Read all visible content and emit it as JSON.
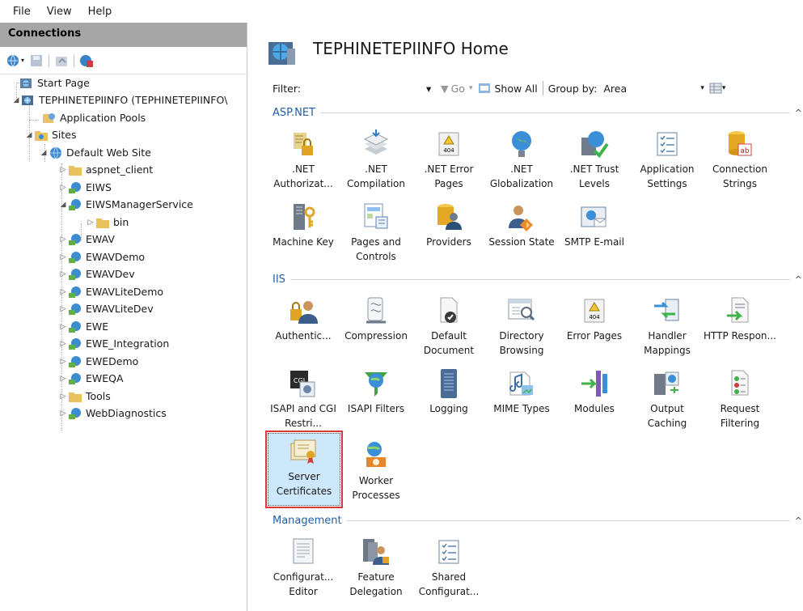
{
  "menu": [
    "File",
    "View",
    "Help"
  ],
  "connections": {
    "header": "Connections",
    "tree": [
      {
        "label": "Start Page",
        "depth": 0,
        "icon": "start-page-icon",
        "expander": ""
      },
      {
        "label": "TEPHINETEPIINFO (TEPHINETEPIINFO\\",
        "depth": 0,
        "icon": "server-icon",
        "expander": "open"
      },
      {
        "label": "Application Pools",
        "depth": 1,
        "icon": "app-pool-icon",
        "expander": ""
      },
      {
        "label": "Sites",
        "depth": 1,
        "icon": "sites-folder-icon",
        "expander": "open"
      },
      {
        "label": "Default Web Site",
        "depth": 2,
        "icon": "globe-icon",
        "expander": "open"
      },
      {
        "label": "aspnet_client",
        "depth": 3,
        "icon": "folder-icon",
        "expander": "closed"
      },
      {
        "label": "EIWS",
        "depth": 3,
        "icon": "web-app-icon",
        "expander": "closed"
      },
      {
        "label": "EIWSManagerService",
        "depth": 3,
        "icon": "web-app-icon",
        "expander": "open"
      },
      {
        "label": "bin",
        "depth": 4,
        "icon": "folder-icon",
        "expander": "closed"
      },
      {
        "label": "EWAV",
        "depth": 3,
        "icon": "web-app-icon",
        "expander": "closed"
      },
      {
        "label": "EWAVDemo",
        "depth": 3,
        "icon": "web-app-icon",
        "expander": "closed"
      },
      {
        "label": "EWAVDev",
        "depth": 3,
        "icon": "web-app-icon",
        "expander": "closed"
      },
      {
        "label": "EWAVLiteDemo",
        "depth": 3,
        "icon": "web-app-icon",
        "expander": "closed"
      },
      {
        "label": "EWAVLiteDev",
        "depth": 3,
        "icon": "web-app-icon",
        "expander": "closed"
      },
      {
        "label": "EWE",
        "depth": 3,
        "icon": "web-app-icon",
        "expander": "closed"
      },
      {
        "label": "EWE_Integration",
        "depth": 3,
        "icon": "web-app-icon",
        "expander": "closed"
      },
      {
        "label": "EWEDemo",
        "depth": 3,
        "icon": "web-app-icon",
        "expander": "closed"
      },
      {
        "label": "EWEQA",
        "depth": 3,
        "icon": "web-app-icon",
        "expander": "closed"
      },
      {
        "label": "Tools",
        "depth": 3,
        "icon": "folder-icon",
        "expander": "closed"
      },
      {
        "label": "WebDiagnostics",
        "depth": 3,
        "icon": "web-app-icon",
        "expander": "closed"
      }
    ]
  },
  "main": {
    "title": "TEPHINETEPIINFO Home",
    "filter": {
      "label": "Filter:",
      "go": "Go",
      "show_all": "Show All",
      "group_by_label": "Group by:",
      "group_by_value": "Area"
    },
    "sections": [
      {
        "title": "ASP.NET",
        "items": [
          {
            "label": ".NET Authorizat...",
            "icon": "net-authorization-icon"
          },
          {
            "label": ".NET Compilation",
            "icon": "net-compilation-icon"
          },
          {
            "label": ".NET Error Pages",
            "icon": "net-error-pages-icon"
          },
          {
            "label": ".NET Globalization",
            "icon": "net-globalization-icon"
          },
          {
            "label": ".NET Trust Levels",
            "icon": "net-trust-levels-icon"
          },
          {
            "label": "Application Settings",
            "icon": "application-settings-icon"
          },
          {
            "label": "Connection Strings",
            "icon": "connection-strings-icon"
          },
          {
            "label": "Machine Key",
            "icon": "machine-key-icon"
          },
          {
            "label": "Pages and Controls",
            "icon": "pages-and-controls-icon"
          },
          {
            "label": "Providers",
            "icon": "providers-icon"
          },
          {
            "label": "Session State",
            "icon": "session-state-icon"
          },
          {
            "label": "SMTP E-mail",
            "icon": "smtp-email-icon"
          }
        ]
      },
      {
        "title": "IIS",
        "items": [
          {
            "label": "Authentic...",
            "icon": "authentication-icon"
          },
          {
            "label": "Compression",
            "icon": "compression-icon"
          },
          {
            "label": "Default Document",
            "icon": "default-document-icon"
          },
          {
            "label": "Directory Browsing",
            "icon": "directory-browsing-icon"
          },
          {
            "label": "Error Pages",
            "icon": "error-pages-icon"
          },
          {
            "label": "Handler Mappings",
            "icon": "handler-mappings-icon"
          },
          {
            "label": "HTTP Respon...",
            "icon": "http-response-icon"
          },
          {
            "label": "ISAPI and CGI Restri...",
            "icon": "isapi-cgi-icon"
          },
          {
            "label": "ISAPI Filters",
            "icon": "isapi-filters-icon"
          },
          {
            "label": "Logging",
            "icon": "logging-icon"
          },
          {
            "label": "MIME Types",
            "icon": "mime-types-icon"
          },
          {
            "label": "Modules",
            "icon": "modules-icon"
          },
          {
            "label": "Output Caching",
            "icon": "output-caching-icon"
          },
          {
            "label": "Request Filtering",
            "icon": "request-filtering-icon"
          },
          {
            "label": "Server Certificates",
            "icon": "server-certificates-icon",
            "selected": true
          },
          {
            "label": "Worker Processes",
            "icon": "worker-processes-icon"
          }
        ]
      },
      {
        "title": "Management",
        "items": [
          {
            "label": "Configurat... Editor",
            "icon": "configuration-editor-icon"
          },
          {
            "label": "Feature Delegation",
            "icon": "feature-delegation-icon"
          },
          {
            "label": "Shared Configurat...",
            "icon": "shared-configuration-icon"
          }
        ]
      }
    ]
  },
  "colors": {
    "section_title": "#1f5fa8",
    "selection_border": "#d9383a",
    "selection_fill": "#cde8fb",
    "connections_header": "#a6a6a6"
  }
}
